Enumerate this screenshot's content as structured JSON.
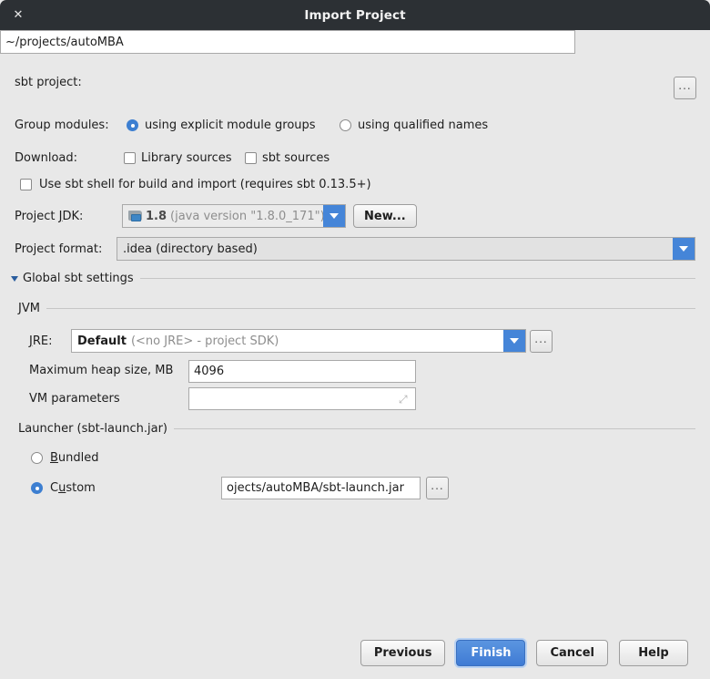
{
  "window": {
    "title": "Import Project",
    "close_icon": "close-icon"
  },
  "fields": {
    "sbt_project_label": "sbt project:",
    "sbt_project_value": "~/projects/autoMBA",
    "browse_ellipsis": "...",
    "group_modules_label": "Group modules:",
    "group_explicit_label": "using explicit module groups",
    "group_qualified_label": "using qualified names",
    "download_label": "Download:",
    "library_sources_label": "Library sources",
    "sbt_sources_label": "sbt sources",
    "use_sbt_shell_label": "Use sbt shell for build and import (requires sbt 0.13.5+)",
    "project_jdk_label": "Project JDK:",
    "project_jdk_value": "1.8",
    "project_jdk_detail": "(java version \"1.8.0_171\")",
    "new_button_label": "New...",
    "project_format_label": "Project format:",
    "project_format_value": ".idea (directory based)"
  },
  "global_sbt": {
    "section_label": "Global sbt settings",
    "jvm_label": "JVM",
    "jre_label": "JRE:",
    "jre_value": "Default",
    "jre_detail": "(<no JRE> - project SDK)",
    "max_heap_label": "Maximum heap size, MB",
    "max_heap_value": "4096",
    "vm_params_label": "VM parameters",
    "vm_params_value": "",
    "expand_icon": "expand-icon"
  },
  "launcher": {
    "section_label": "Launcher (sbt-launch.jar)",
    "bundled_label": "Bundled",
    "custom_label": "Custom",
    "custom_path_value": "ojects/autoMBA/sbt-launch.jar",
    "browse_ellipsis": "..."
  },
  "buttons": {
    "previous": "Previous",
    "finish": "Finish",
    "cancel": "Cancel",
    "help": "Help"
  },
  "colors": {
    "titlebar": "#2c3034",
    "accent_blue": "#4585d8",
    "radio_blue": "#3d7fd1",
    "background": "#e8e8e8"
  }
}
